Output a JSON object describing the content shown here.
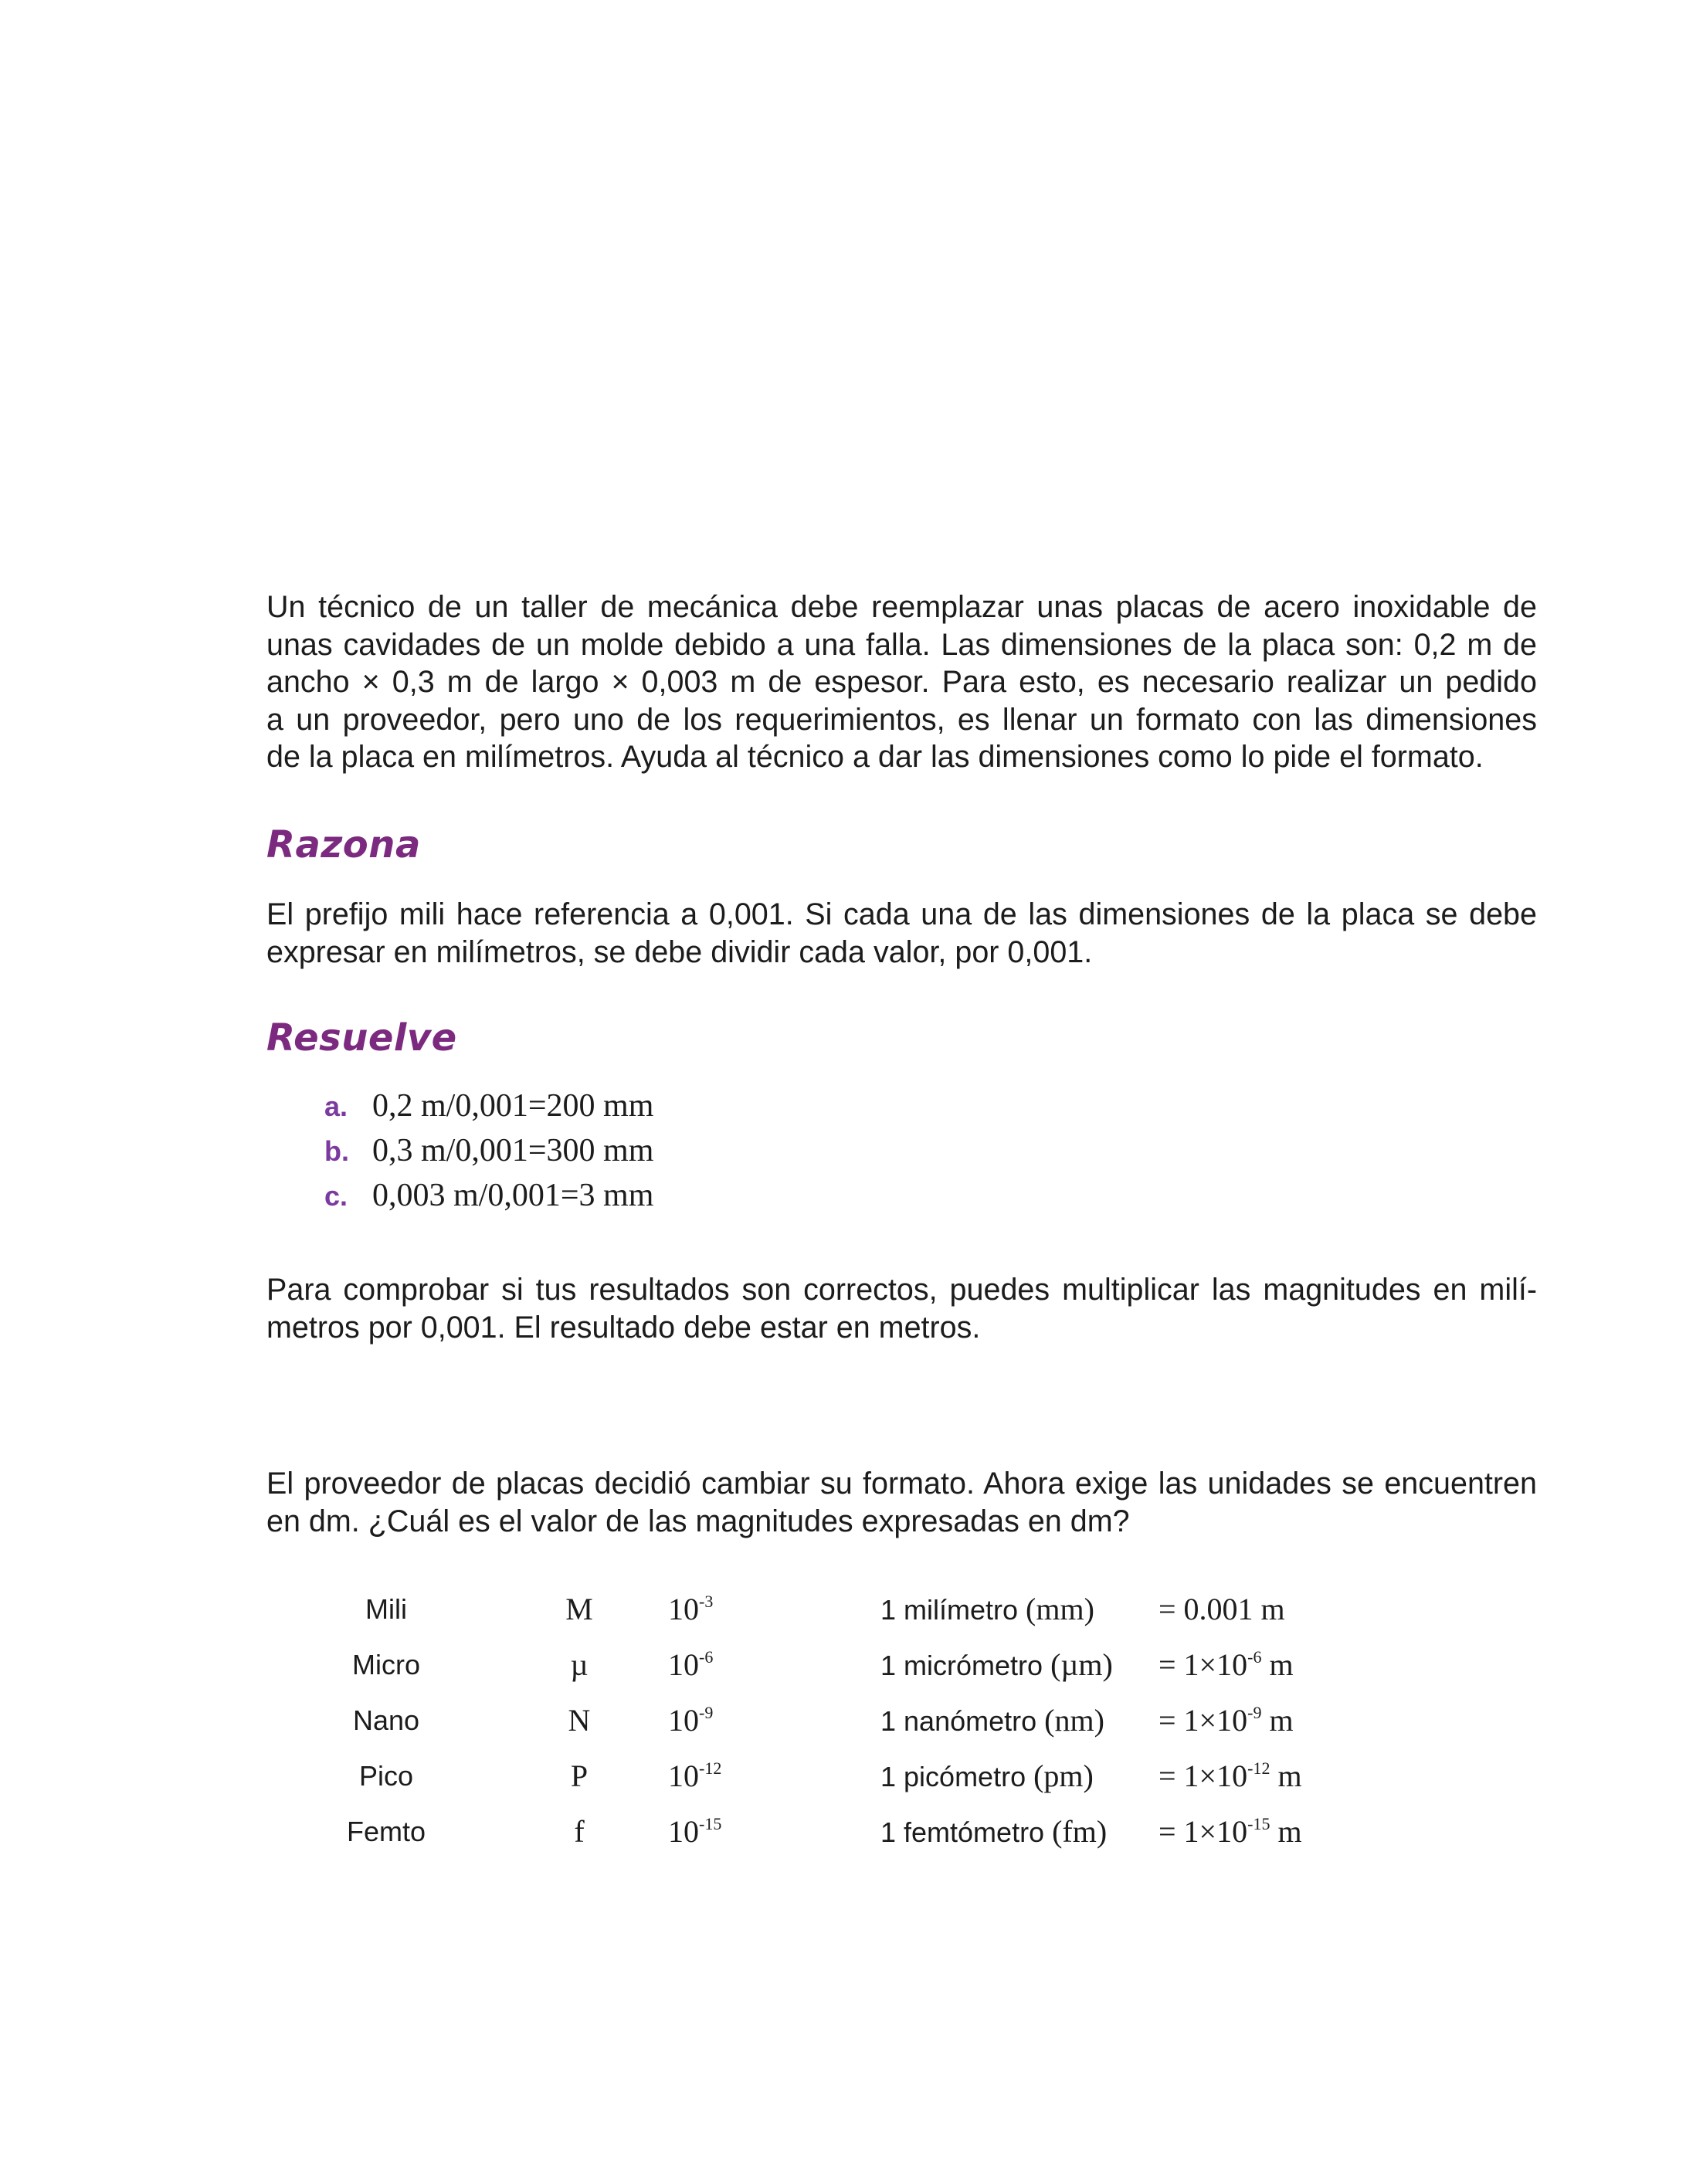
{
  "intro": {
    "lines": [
      "Un técnico de un taller de mecánica debe reemplazar unas placas de acero inoxidable de",
      "unas cavidades de un molde debido a una falla. Las dimensiones de la placa son: 0,2 m de",
      "ancho × 0,3 m de largo × 0,003 m de espesor. Para esto, es necesario realizar un pedido",
      "a un proveedor, pero uno de los requerimientos, es llenar un formato con las dimensiones",
      "de la placa en milímetros. Ayuda al técnico a dar las dimensiones como lo pide el formato."
    ]
  },
  "razona": {
    "heading": "Razona",
    "lines": [
      "El prefijo mili hace referencia a 0,001. Si cada una de las dimensiones de la placa se debe",
      "expresar en milímetros, se debe dividir cada valor, por 0,001."
    ]
  },
  "resuelve": {
    "heading": "Resuelve",
    "items": [
      {
        "label": "a.",
        "expr": "0,2 m/0,001=200 mm"
      },
      {
        "label": "b.",
        "expr": "0,3 m/0,001=300 mm"
      },
      {
        "label": "c.",
        "expr": "0,003 m/0,001=3 mm"
      }
    ]
  },
  "check": {
    "lines": [
      "Para comprobar si tus resultados son correctos, puedes multiplicar las magnitudes en milí-",
      "metros por 0,001. El resultado debe estar en metros."
    ]
  },
  "proveedor": {
    "lines": [
      "El proveedor de placas decidió cambiar su formato. Ahora exige las unidades se encuentren",
      "en dm. ¿Cuál es el valor de las magnitudes expresadas en dm?"
    ]
  },
  "prefixes": [
    {
      "name": "Mili",
      "symbol": "M",
      "base": "10",
      "exp": "-3",
      "def_word": "1 milímetro",
      "def_unit": "(mm)",
      "eq_pre": "= 0.001 m",
      "eq_exp": "",
      "eq_post": ""
    },
    {
      "name": "Micro",
      "symbol": "µ",
      "base": "10",
      "exp": "-6",
      "def_word": "1 micrómetro",
      "def_unit": "(µm)",
      "eq_pre": "= 1×10",
      "eq_exp": "-6",
      "eq_post": " m"
    },
    {
      "name": "Nano",
      "symbol": "N",
      "base": "10",
      "exp": "-9",
      "def_word": "1 nanómetro",
      "def_unit": "(nm)",
      "eq_pre": "= 1×10",
      "eq_exp": "-9",
      "eq_post": " m"
    },
    {
      "name": "Pico",
      "symbol": "P",
      "base": "10",
      "exp": "-12",
      "def_word": "1 picómetro",
      "def_unit": "(pm)",
      "eq_pre": "= 1×10",
      "eq_exp": "-12",
      "eq_post": " m"
    },
    {
      "name": "Femto",
      "symbol": "f",
      "base": "10",
      "exp": "-15",
      "def_word": "1 femtómetro",
      "def_unit": "(fm)",
      "eq_pre": "= 1×10",
      "eq_exp": "-15",
      "eq_post": " m"
    }
  ],
  "colors": {
    "heading": "#7b2a7f",
    "list_label": "#7b3aa0",
    "text": "#1c1c1c"
  }
}
